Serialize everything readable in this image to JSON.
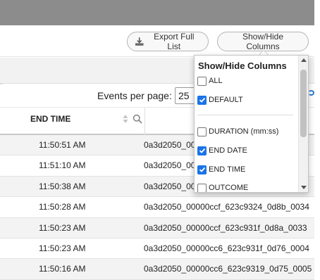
{
  "toolbar": {
    "export_label": "Export Full List",
    "showhide_label": "Show/Hide Columns"
  },
  "pagination": {
    "events_per_page_label": "Events per page:",
    "events_per_page_value": "25"
  },
  "table": {
    "visible_column_header": "END TIME",
    "rows": [
      {
        "end_time": "11:50:51 AM",
        "id": "0a3d2050_00"
      },
      {
        "end_time": "11:51:10 AM",
        "id": "0a3d2050_00"
      },
      {
        "end_time": "11:50:38 AM",
        "id": "0a3d2050_00"
      },
      {
        "end_time": "11:50:28 AM",
        "id": "0a3d2050_00000ccf_623c9324_0d8b_0034"
      },
      {
        "end_time": "11:50:23 AM",
        "id": "0a3d2050_00000ccf_623c931f_0d8a_0033"
      },
      {
        "end_time": "11:50:23 AM",
        "id": "0a3d2050_00000cc6_623c931f_0d76_0004"
      },
      {
        "end_time": "11:50:16 AM",
        "id": "0a3d2050_00000cc6_623c9319_0d75_0005"
      }
    ]
  },
  "popup": {
    "title": "Show/Hide Columns",
    "options": [
      {
        "label": "ALL",
        "checked": false
      },
      {
        "label": "DEFAULT",
        "checked": true
      },
      {
        "label": "DURATION (mm:ss)",
        "checked": false
      },
      {
        "label": "END DATE",
        "checked": true
      },
      {
        "label": "END TIME",
        "checked": true
      },
      {
        "label": "OUTCOME",
        "checked": false
      }
    ]
  },
  "colors": {
    "checkbox_checked": "#1a73e8",
    "topbar": "#8c8c8c"
  }
}
